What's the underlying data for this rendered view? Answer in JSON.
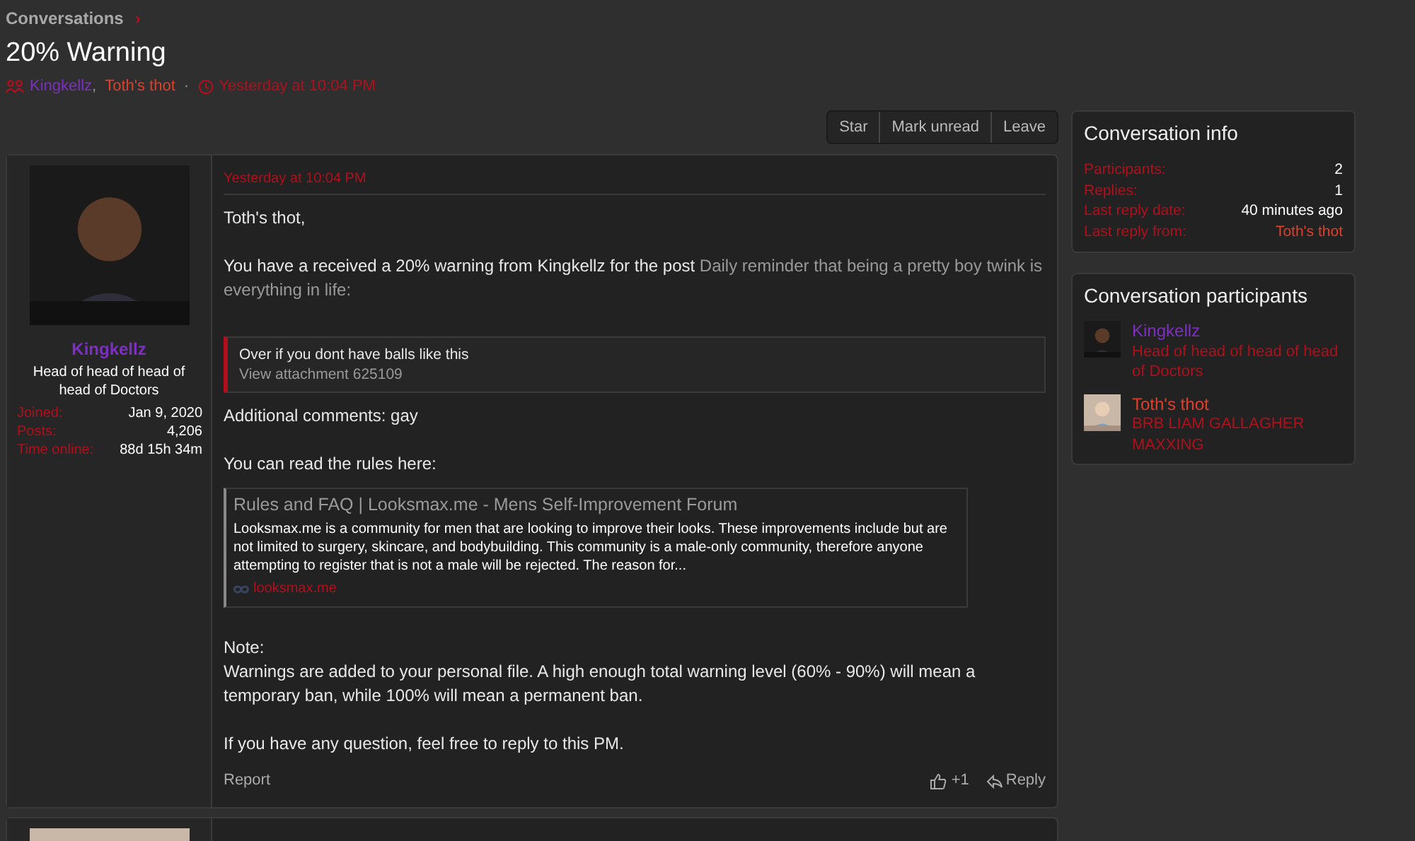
{
  "breadcrumb": {
    "label": "Conversations",
    "separator": "›"
  },
  "title": "20% Warning",
  "meta": {
    "participants": [
      {
        "name": "Kingkellz",
        "color": "#7d2fc4"
      },
      {
        "name": "Toth's thot",
        "color": "#e0402a"
      }
    ],
    "separator": ",",
    "dot": "·",
    "time": "Yesterday at 10:04 PM"
  },
  "actions": [
    "Star",
    "Mark unread",
    "Leave"
  ],
  "message": {
    "author": {
      "name": "Kingkellz",
      "color": "#7d2fc4",
      "title": "Head of head of head of head of Doctors",
      "stats": [
        {
          "label": "Joined:",
          "value": "Jan 9, 2020"
        },
        {
          "label": "Posts:",
          "value": "4,206"
        },
        {
          "label": "Time online:",
          "value": "88d 15h 34m"
        }
      ]
    },
    "time": "Yesterday at 10:04 PM",
    "greeting": "Toth's thot,",
    "intro": "You have a received a 20% warning from Kingkellz for the post ",
    "post_link": "Daily reminder that being a pretty boy twink is everything in life:",
    "quote": {
      "text": "Over if you dont have balls like this",
      "attachment": "View attachment 625109"
    },
    "comments": "Additional comments: gay",
    "rules_intro": "You can read the rules here:",
    "preview": {
      "title": "Rules and FAQ | Looksmax.me - Mens Self-Improvement Forum",
      "description": "Looksmax.me is a community for men that are looking to improve their looks. These improvements include but are not limited to surgery, skincare, and bodybuilding. This community is a male-only community, therefore anyone attempting to register that is not a male will be rejected. The reason for...",
      "domain": "looksmax.me"
    },
    "note_label": "Note:",
    "note": "Warnings are added to your personal file. A high enough total warning level (60% - 90%) will mean a temporary ban, while 100% will mean a permanent ban.",
    "closing": "If you have any question, feel free to reply to this PM.",
    "report": "Report",
    "likes": "+1",
    "reply": "Reply"
  },
  "info": {
    "title": "Conversation info",
    "rows": [
      {
        "label": "Participants:",
        "value": "2",
        "kind": "plain"
      },
      {
        "label": "Replies:",
        "value": "1",
        "kind": "plain"
      },
      {
        "label": "Last reply date:",
        "value": "40 minutes ago",
        "kind": "plain"
      },
      {
        "label": "Last reply from:",
        "value": "Toth's thot",
        "kind": "user",
        "color": "#e0402a"
      }
    ]
  },
  "participants_panel": {
    "title": "Conversation participants",
    "people": [
      {
        "name": "Kingkellz",
        "color": "#7d2fc4",
        "title": "Head of head of head of head of Doctors"
      },
      {
        "name": "Toth's thot",
        "color": "#e0402a",
        "title": "BRB LIAM GALLAGHER MAXXING"
      }
    ]
  }
}
